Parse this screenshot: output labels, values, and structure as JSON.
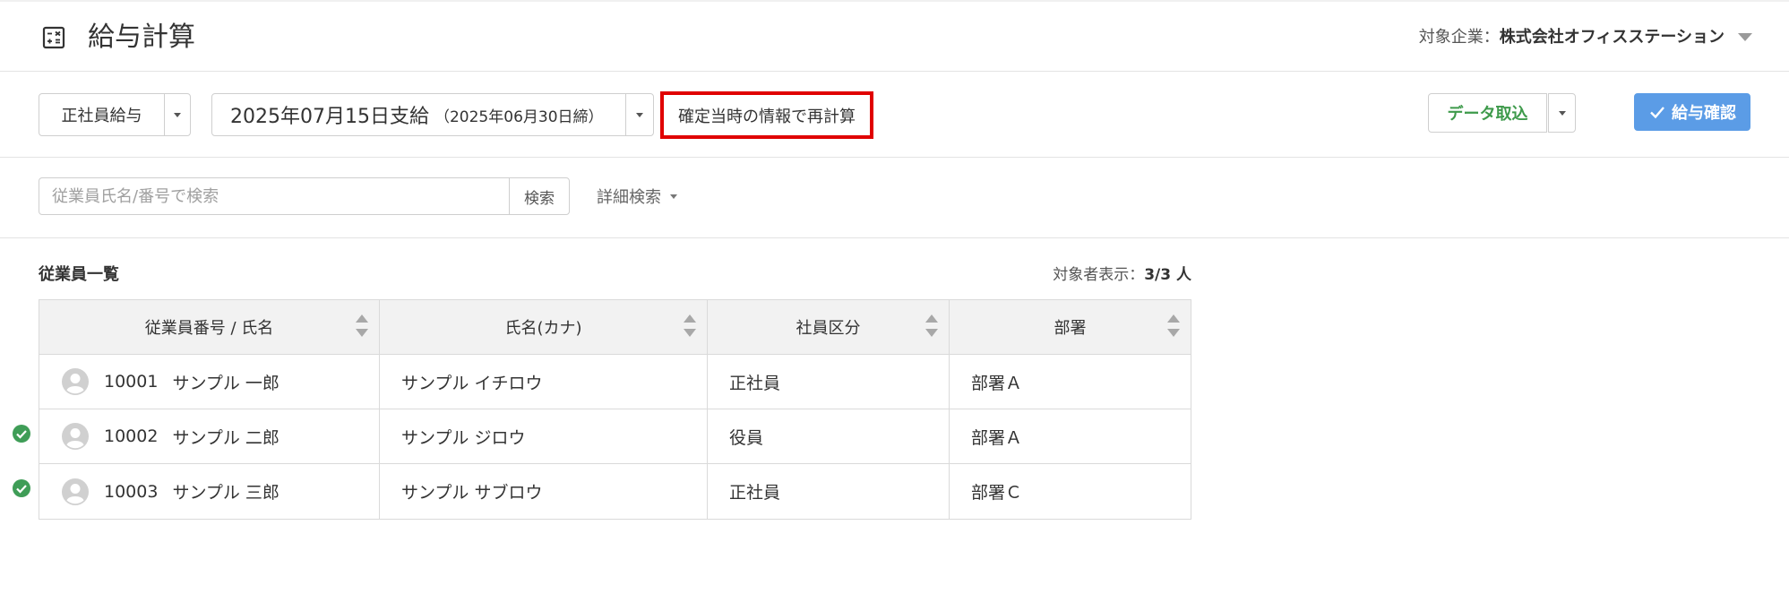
{
  "header": {
    "title": "給与計算",
    "company_label": "対象企業：",
    "company_name": "株式会社オフィスステーション"
  },
  "toolbar": {
    "pay_type": "正社員給与",
    "period_main": "2025年07月15日支給",
    "period_sub": "（2025年06月30日締）",
    "recalc_label": "確定当時の情報で再計算",
    "data_import_label": "データ取込",
    "confirm_label": "給与確認"
  },
  "search": {
    "placeholder": "従業員氏名/番号で検索",
    "button_label": "検索",
    "advanced_label": "詳細検索"
  },
  "list": {
    "title": "従業員一覧",
    "count_label": "対象者表示：",
    "count_value": "3/3 人",
    "columns": [
      "従業員番号 / 氏名",
      "氏名(カナ)",
      "社員区分",
      "部署"
    ],
    "rows": [
      {
        "confirmed": false,
        "number": "10001",
        "name": "サンプル 一郎",
        "kana": "サンプル イチロウ",
        "type": "正社員",
        "dept": "部署Ａ"
      },
      {
        "confirmed": true,
        "number": "10002",
        "name": "サンプル 二郎",
        "kana": "サンプル ジロウ",
        "type": "役員",
        "dept": "部署Ａ"
      },
      {
        "confirmed": true,
        "number": "10003",
        "name": "サンプル 三郎",
        "kana": "サンプル サブロウ",
        "type": "正社員",
        "dept": "部署Ｃ"
      }
    ]
  },
  "colors": {
    "accent_blue": "#5b9ce6",
    "import_green": "#3e9a4b",
    "confirmed_green": "#3f9d57",
    "highlight_red": "#e00000"
  }
}
